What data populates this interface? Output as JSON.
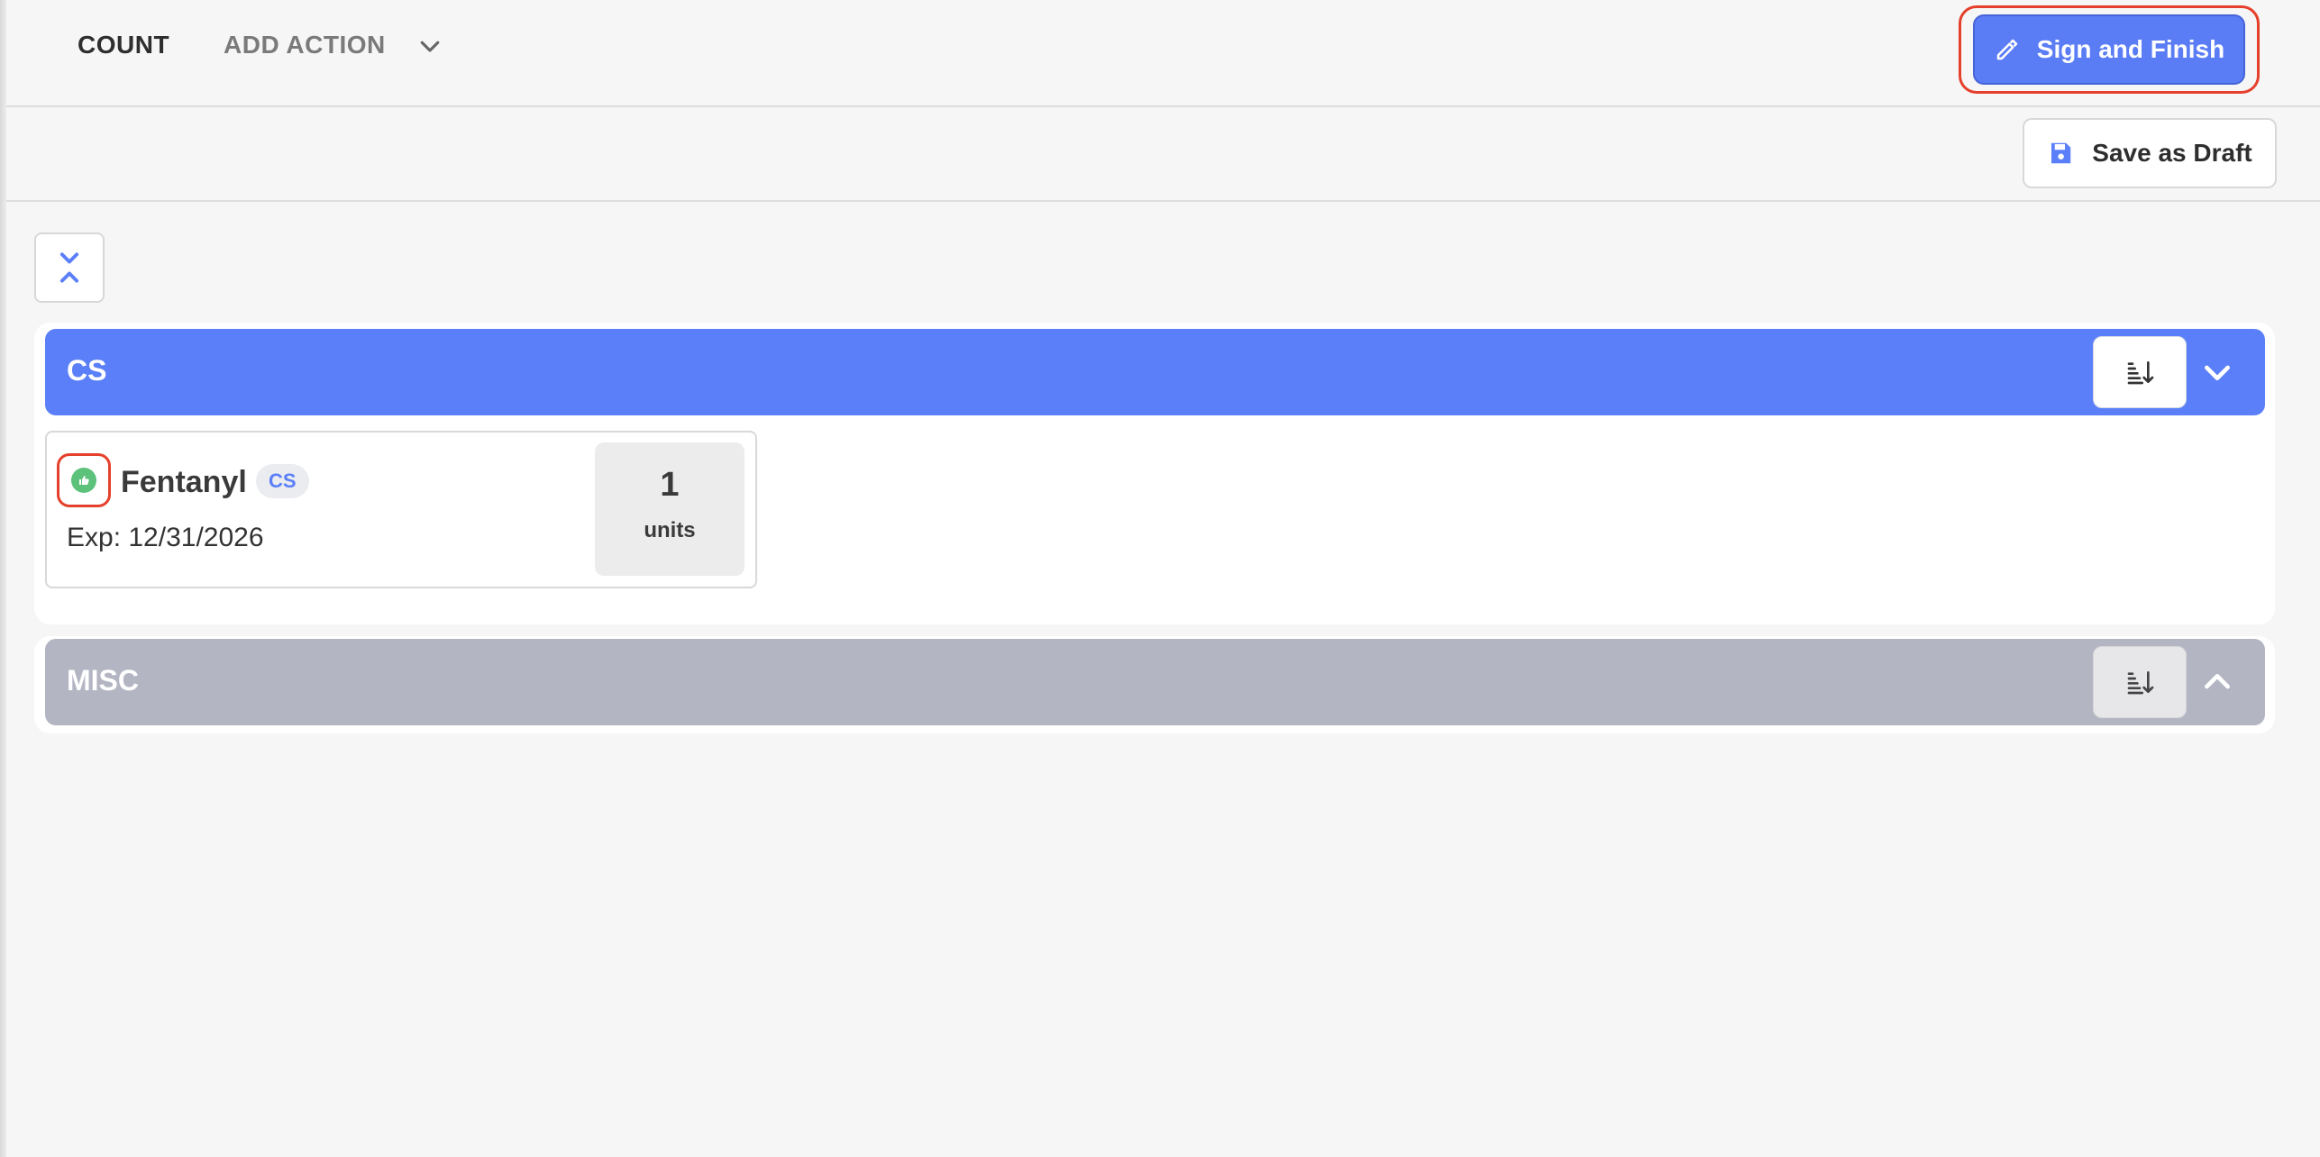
{
  "tabs": {
    "count_label": "COUNT",
    "add_action_label": "ADD ACTION"
  },
  "actions": {
    "sign_and_finish_label": "Sign and Finish",
    "save_draft_label": "Save as Draft"
  },
  "colors": {
    "accent": "#5b7ff8",
    "misc_header": "#b3b5c2",
    "highlight_ring": "#e5402b",
    "status_ok": "#5cc17a"
  },
  "groups": [
    {
      "title": "CS",
      "expanded": true,
      "items": [
        {
          "name": "Fentanyl",
          "badge": "CS",
          "expiry": "Exp: 12/31/2026",
          "quantity": "1",
          "unit": "units",
          "status_icon": "thumbs-up-icon"
        }
      ]
    },
    {
      "title": "MISC",
      "expanded": false,
      "items": []
    }
  ]
}
